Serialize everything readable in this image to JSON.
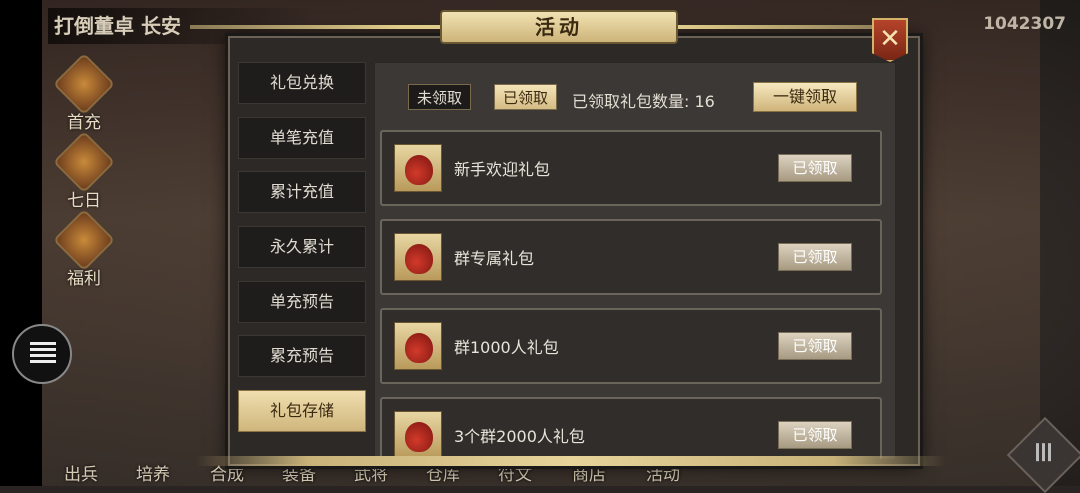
{
  "hud": {
    "title": "打倒董卓 长安",
    "number": "1042307",
    "side_icons": [
      "首充",
      "七日",
      "福利"
    ],
    "bottom_items": [
      "出兵",
      "培养",
      "合成",
      "装备",
      "武将",
      "仓库",
      "符文",
      "商店",
      "活动"
    ]
  },
  "dialog": {
    "title": "活动",
    "close_label": "✕",
    "tabs": [
      "礼包兑换",
      "单笔充值",
      "累计充值",
      "永久累计",
      "单充预告",
      "累充预告",
      "礼包存储"
    ],
    "active_tab": "礼包存储",
    "filter": {
      "unclaimed_label": "未领取",
      "claimed_label": "已领取",
      "count_label": "已领取礼包数量: 16",
      "one_key_label": "一键领取"
    },
    "items": [
      {
        "name": "新手欢迎礼包",
        "status": "已领取"
      },
      {
        "name": "群专属礼包",
        "status": "已领取"
      },
      {
        "name": "群1000人礼包",
        "status": "已领取"
      },
      {
        "name": "3个群2000人礼包",
        "status": "已领取"
      }
    ]
  },
  "colors": {
    "gold": "#e0cc8a",
    "panel": "#2c2926",
    "close_red": "#b5442a"
  }
}
